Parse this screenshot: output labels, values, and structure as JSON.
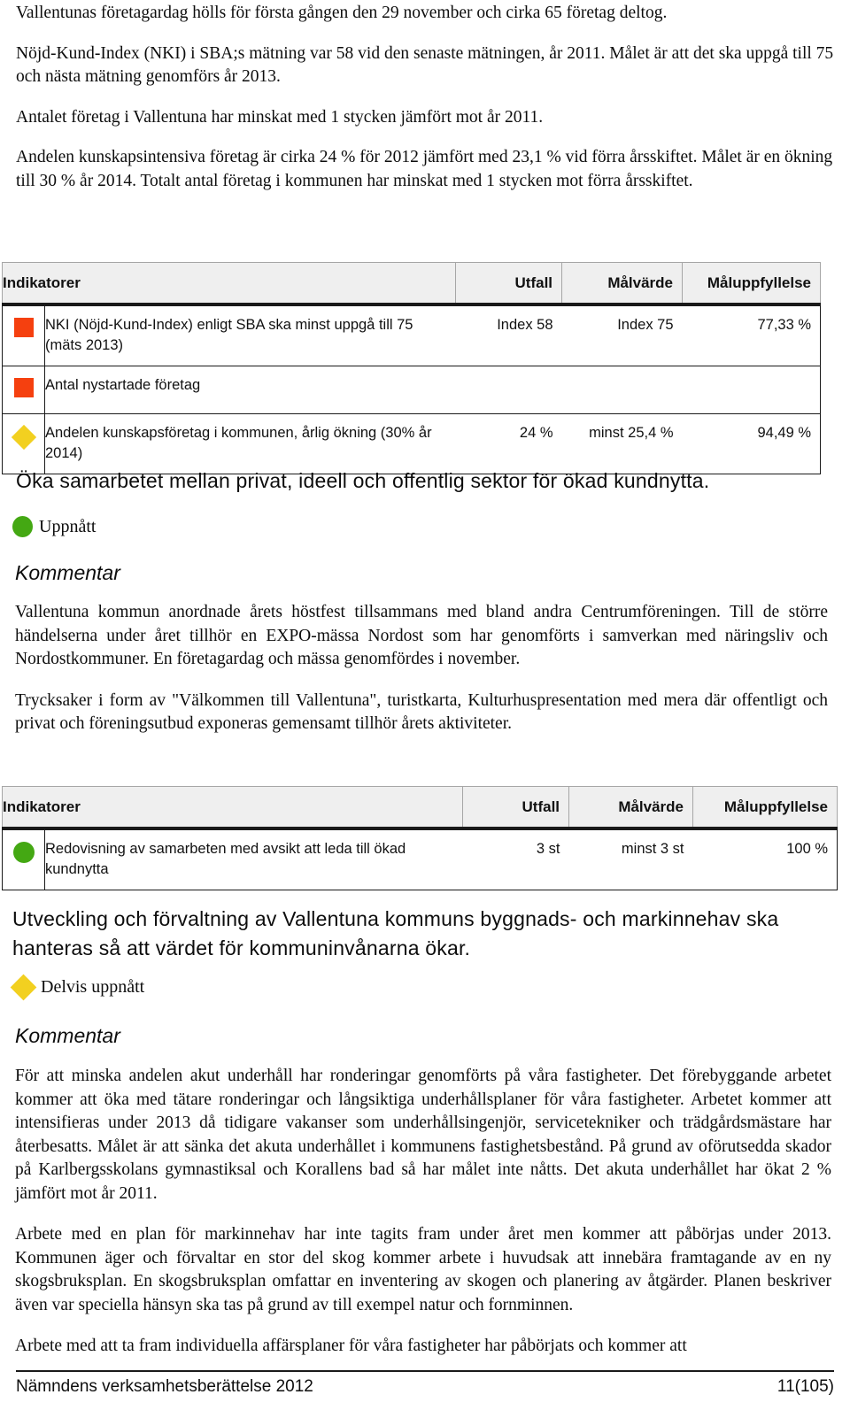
{
  "intro_paragraphs": [
    "Vallentunas företagardag hölls för första gången den 29 november och cirka 65 företag deltog.",
    "Nöjd-Kund-Index (NKI) i SBA;s mätning var 58 vid den senaste mätningen, år 2011. Målet är att det ska uppgå till 75 och nästa mätning genomförs år 2013.",
    "Antalet företag i Vallentuna har minskat med 1 stycken jämfört mot år 2011.",
    "Andelen kunskapsintensiva företag är cirka 24 % för 2012 jämfört med 23,1 % vid förra årsskiftet. Målet är en ökning till 30 % år 2014. Totalt antal företag i kommunen har minskat med 1 stycken mot förra årsskiftet."
  ],
  "table_1": {
    "headers": {
      "indicators": "Indikatorer",
      "utfall": "Utfall",
      "malvarde": "Målvärde",
      "maluppfyllelse": "Måluppfyllelse"
    },
    "rows": [
      {
        "marker": "square-red",
        "indicator": "NKI (Nöjd-Kund-Index) enligt SBA ska minst uppgå till 75 (mäts 2013)",
        "utfall": "Index 58",
        "malvarde": "Index 75",
        "maluppfyllelse": "77,33 %"
      },
      {
        "marker": "square-red",
        "indicator": "Antal nystartade företag",
        "utfall": "",
        "malvarde": "",
        "maluppfyllelse": ""
      },
      {
        "marker": "diamond-yellow",
        "indicator": "Andelen kunskapsföretag i kommunen, årlig ökning (30% år 2014)",
        "utfall": "24 %",
        "malvarde": "minst 25,4 %",
        "maluppfyllelse": "94,49 %"
      }
    ]
  },
  "goal_2": {
    "heading": "Öka samarbetet mellan privat, ideell och offentlig sektor för ökad kundnytta.",
    "status_marker": "circle-green",
    "status_label": "Uppnått",
    "kommentar_label": "Kommentar",
    "comment_paragraphs": [
      "Vallentuna kommun anordnade årets höstfest tillsammans med bland andra Centrumföreningen. Till de större händelserna under året tillhör en EXPO-mässa Nordost som har genomförts i samverkan med näringsliv och Nordostkommuner. En företagardag och mässa genomfördes i november.",
      "Trycksaker i form av \"Välkommen till Vallentuna\", turistkarta, Kulturhuspresentation med mera där offentligt och privat och föreningsutbud exponeras gemensamt tillhör årets aktiviteter."
    ]
  },
  "table_2": {
    "headers": {
      "indicators": "Indikatorer",
      "utfall": "Utfall",
      "malvarde": "Målvärde",
      "maluppfyllelse": "Måluppfyllelse"
    },
    "rows": [
      {
        "marker": "circle-green",
        "indicator": "Redovisning av samarbeten med avsikt att leda till ökad kundnytta",
        "utfall": "3 st",
        "malvarde": "minst 3 st",
        "maluppfyllelse": "100 %"
      }
    ]
  },
  "goal_3": {
    "heading": "Utveckling och förvaltning av Vallentuna kommuns byggnads- och markinnehav ska hanteras så att värdet för kommuninvånarna ökar.",
    "status_marker": "diamond-yellow",
    "status_label": "Delvis uppnått",
    "kommentar_label": "Kommentar",
    "comment_paragraphs": [
      "För att minska andelen akut underhåll har ronderingar genomförts på våra fastigheter. Det förebyggande arbetet kommer att öka med tätare ronderingar och långsiktiga underhållsplaner för våra fastigheter. Arbetet kommer att intensifieras under 2013 då tidigare vakanser som underhållsingenjör, servicetekniker och trädgårdsmästare har återbesatts. Målet är att sänka det akuta underhållet i kommunens fastighetsbestånd. På grund av oförutsedda skador på Karlbergsskolans gymnastiksal och Korallens bad så har målet inte nåtts. Det akuta underhållet har ökat 2 % jämfört mot år 2011.",
      "Arbete med en plan för markinnehav har inte tagits fram under året men kommer att påbörjas under 2013. Kommunen äger och förvaltar en stor del skog kommer arbete i huvudsak att innebära framtagande av en ny skogsbruksplan. En skogsbruksplan omfattar en inventering av skogen och planering av åtgärder. Planen beskriver även var speciella hänsyn ska tas på grund av till exempel natur och fornminnen.",
      "Arbete med att ta fram individuella affärsplaner för våra fastigheter har påbörjats och kommer att"
    ]
  },
  "footer": {
    "document_title": "Nämndens verksamhetsberättelse 2012",
    "page_number": "11(105)"
  },
  "colors": {
    "marker_red": "#f5400f",
    "marker_yellow": "#f2d020",
    "marker_green": "#44a813",
    "table_header_bg": "#efefef",
    "rule": "#1a1a1a"
  }
}
